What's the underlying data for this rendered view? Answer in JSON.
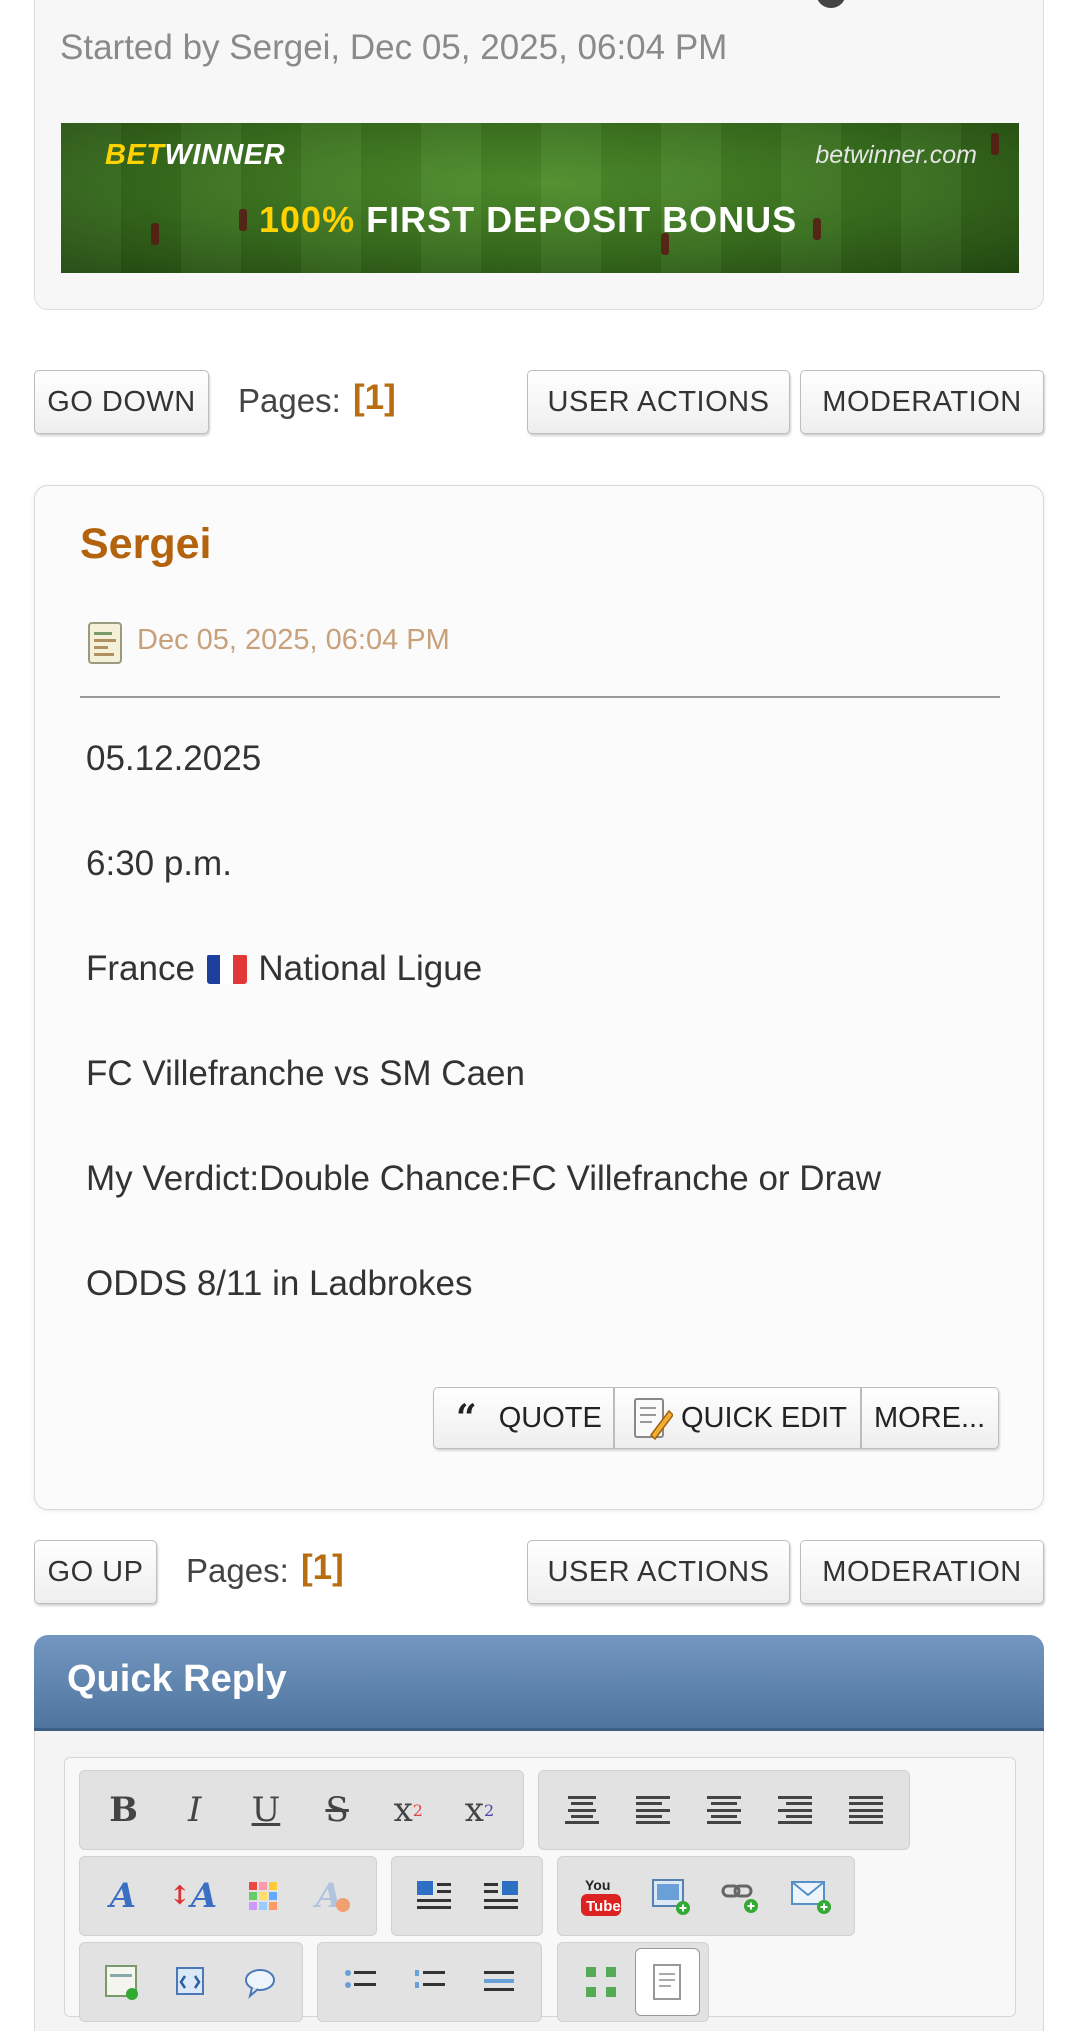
{
  "topic": {
    "started_by": "Started by Sergei, Dec 05, 2025, 06:04 PM"
  },
  "banner": {
    "brand_bet": "BET",
    "brand_winner": "WINNER",
    "site": "betwinner.com",
    "promo_pct": "100%",
    "promo_text": "FIRST DEPOSIT BONUS"
  },
  "pager_top": {
    "nav_button": "GO DOWN",
    "pages_label": "Pages:",
    "pages_value": "[1]",
    "user_actions": "USER ACTIONS",
    "moderation": "MODERATION"
  },
  "post": {
    "author": "Sergei",
    "date": "Dec 05, 2025, 06:04 PM",
    "lines": [
      "05.12.2025",
      "6:30 p.m.",
      "France",
      "National Ligue",
      "FC Villefranche vs SM Caen",
      "My Verdict:Double Chance:FC Villefranche or Draw",
      "ODDS 8/11 in Ladbrokes"
    ],
    "actions": {
      "quote": "QUOTE",
      "quick_edit": "QUICK EDIT",
      "more": "MORE..."
    }
  },
  "pager_bottom": {
    "nav_button": "GO UP",
    "pages_label": "Pages:",
    "pages_value": "[1]",
    "user_actions": "USER ACTIONS",
    "moderation": "MODERATION"
  },
  "quick_reply": {
    "title": "Quick Reply",
    "toolbar_icons": [
      "bold-icon",
      "italic-icon",
      "underline-icon",
      "strikethrough-icon",
      "superscript-icon",
      "subscript-icon",
      "center-icon",
      "align-left-icon",
      "align-center-icon",
      "align-right-icon",
      "justify-icon",
      "font-face-icon",
      "font-size-icon",
      "color-icon",
      "remove-format-icon",
      "float-left-icon",
      "float-right-icon",
      "youtube-icon",
      "image-icon",
      "link-icon",
      "email-icon"
    ]
  },
  "colors": {
    "accent": "#b86d10",
    "header_blue": "#5e84ae",
    "date_tan": "#c8a07a"
  }
}
